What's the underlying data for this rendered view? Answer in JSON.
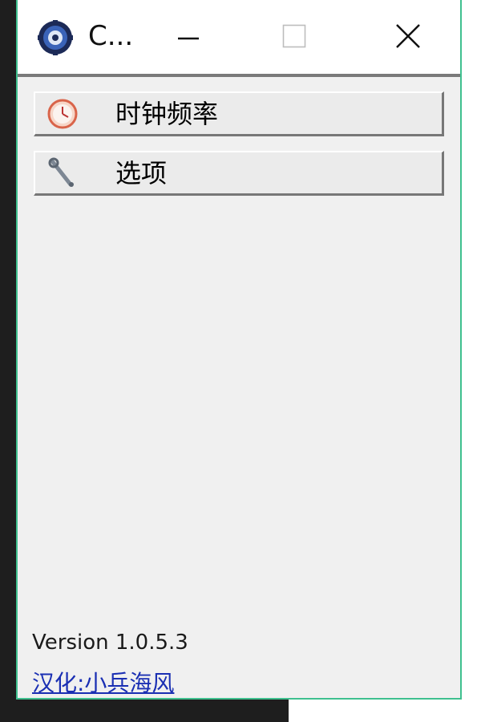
{
  "window": {
    "title": "C...",
    "minimize_label": "minimize",
    "maximize_label": "maximize",
    "close_label": "close"
  },
  "menu": {
    "items": [
      {
        "label": "时钟频率",
        "icon": "clock-icon"
      },
      {
        "label": "选项",
        "icon": "wrench-icon"
      }
    ]
  },
  "footer": {
    "version": "Version 1.0.5.3",
    "credit": "汉化:小兵海风"
  },
  "colors": {
    "window_border": "#3fc08f",
    "link": "#1a2fb3",
    "background": "#f0f0f0"
  }
}
